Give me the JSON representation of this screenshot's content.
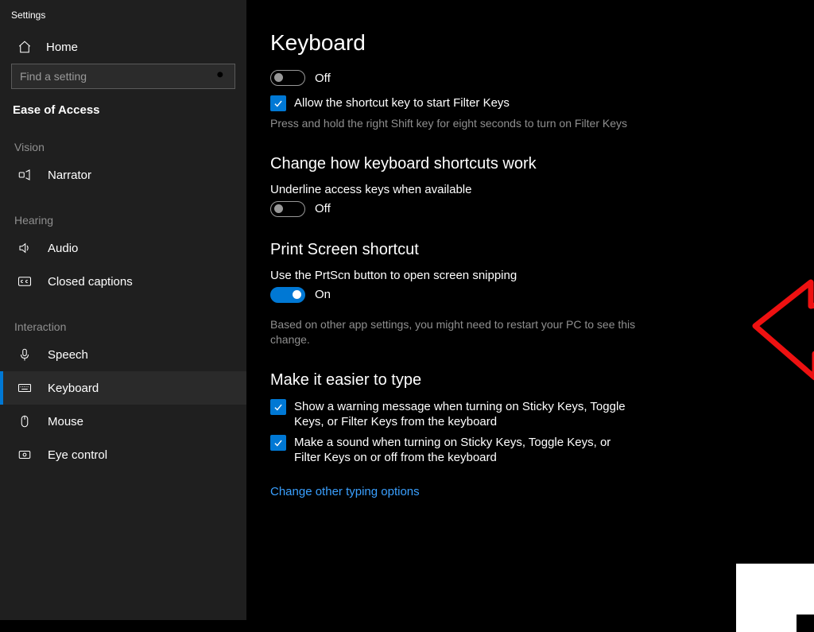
{
  "window_title": "Settings",
  "sidebar": {
    "home": "Home",
    "search_placeholder": "Find a setting",
    "category": "Ease of Access",
    "groups": [
      {
        "label": "Vision",
        "items": [
          {
            "icon": "narrator",
            "label": "Narrator"
          }
        ]
      },
      {
        "label": "Hearing",
        "items": [
          {
            "icon": "audio",
            "label": "Audio"
          },
          {
            "icon": "cc",
            "label": "Closed captions"
          }
        ]
      },
      {
        "label": "Interaction",
        "items": [
          {
            "icon": "speech",
            "label": "Speech"
          },
          {
            "icon": "keyboard",
            "label": "Keyboard",
            "selected": true
          },
          {
            "icon": "mouse",
            "label": "Mouse"
          },
          {
            "icon": "eye",
            "label": "Eye control"
          }
        ]
      }
    ]
  },
  "main": {
    "title": "Keyboard",
    "toggle1_state": "Off",
    "check_allow_shortcut": "Allow the shortcut key to start Filter Keys",
    "filter_keys_hint": "Press and hold the right Shift key for eight seconds to turn on Filter Keys",
    "section_shortcuts": "Change how keyboard shortcuts work",
    "underline_label": "Underline access keys when available",
    "underline_state": "Off",
    "section_prtscn": "Print Screen shortcut",
    "prtscn_desc": "Use the PrtScn button to open screen snipping",
    "prtscn_state": "On",
    "prtscn_hint": "Based on other app settings, you might need to restart your PC to see this change.",
    "section_easier": "Make it easier to type",
    "easier_check1": "Show a warning message when turning on Sticky Keys, Toggle Keys, or Filter Keys from the keyboard",
    "easier_check2": "Make a sound when turning on Sticky Keys, Toggle Keys, or Filter Keys on or off from the keyboard",
    "link_other": "Change other typing options"
  }
}
